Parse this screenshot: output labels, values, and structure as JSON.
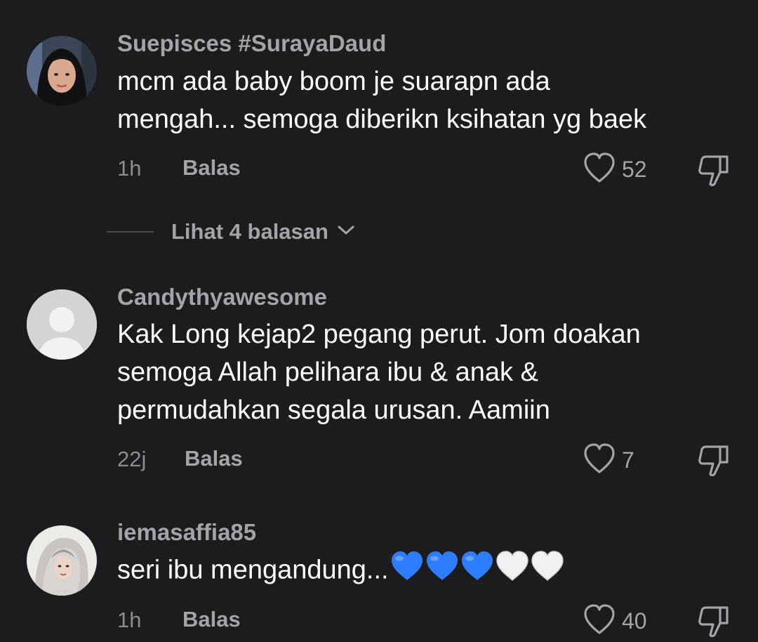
{
  "comments": [
    {
      "username": "Suepisces #SurayaDaud",
      "text_lines": [
        "mcm ada baby boom je suarapn ada",
        "mengah... semoga diberikn ksihatan yg baek"
      ],
      "time": "1h",
      "reply_label": "Balas",
      "likes": "52"
    },
    {
      "username": "Candythyawesome",
      "text_lines": [
        "Kak Long kejap2 pegang perut. Jom doakan",
        "semoga Allah pelihara ibu & anak &",
        "permudahkan segala urusan. Aamiin"
      ],
      "time": "22j",
      "reply_label": "Balas",
      "likes": "7"
    },
    {
      "username": "iemasaffia85",
      "text_lines": [
        "seri ibu mengandung..."
      ],
      "emoji": [
        "blue-heart",
        "blue-heart",
        "blue-heart",
        "white-heart",
        "white-heart"
      ],
      "time": "1h",
      "reply_label": "Balas",
      "likes": "40"
    }
  ],
  "view_replies": {
    "label": "Lihat 4 balasan"
  },
  "icons": {
    "like": "heart-outline-icon",
    "dislike": "thumbs-down-icon",
    "expand": "chevron-down-icon",
    "default_avatar": "person-silhouette-icon"
  },
  "colors": {
    "background": "#1c1c1e",
    "text_primary": "#ffffff",
    "text_secondary": "#a3a3a8",
    "blue_heart": "#2f7dff",
    "white_heart": "#f1f1f4"
  }
}
